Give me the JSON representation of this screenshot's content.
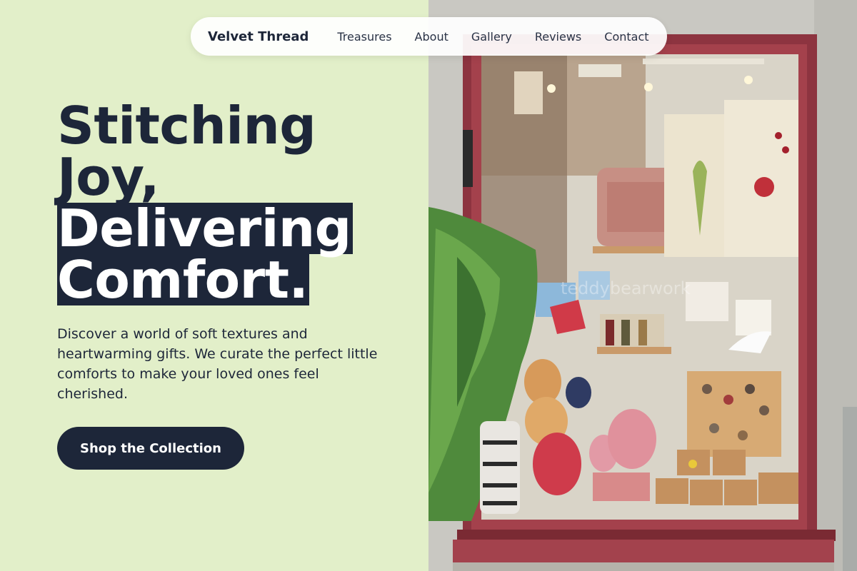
{
  "nav": {
    "brand": "Velvet Thread",
    "links": [
      "Treasures",
      "About",
      "Gallery",
      "Reviews",
      "Contact"
    ]
  },
  "hero": {
    "headline_line1": "Stitching",
    "headline_line2": "Joy,",
    "headline_line3": "Delivering",
    "headline_line4": "Comfort.",
    "description": "Discover a world of soft textures and heartwarming gifts. We curate the perfect little comforts to make your loved ones feel cherished.",
    "cta_label": "Shop the Collection"
  },
  "photo": {
    "window_text": "teddybearwork"
  },
  "colors": {
    "background": "#e2efc9",
    "navy": "#1d2639",
    "window_frame": "#9e3b46"
  }
}
